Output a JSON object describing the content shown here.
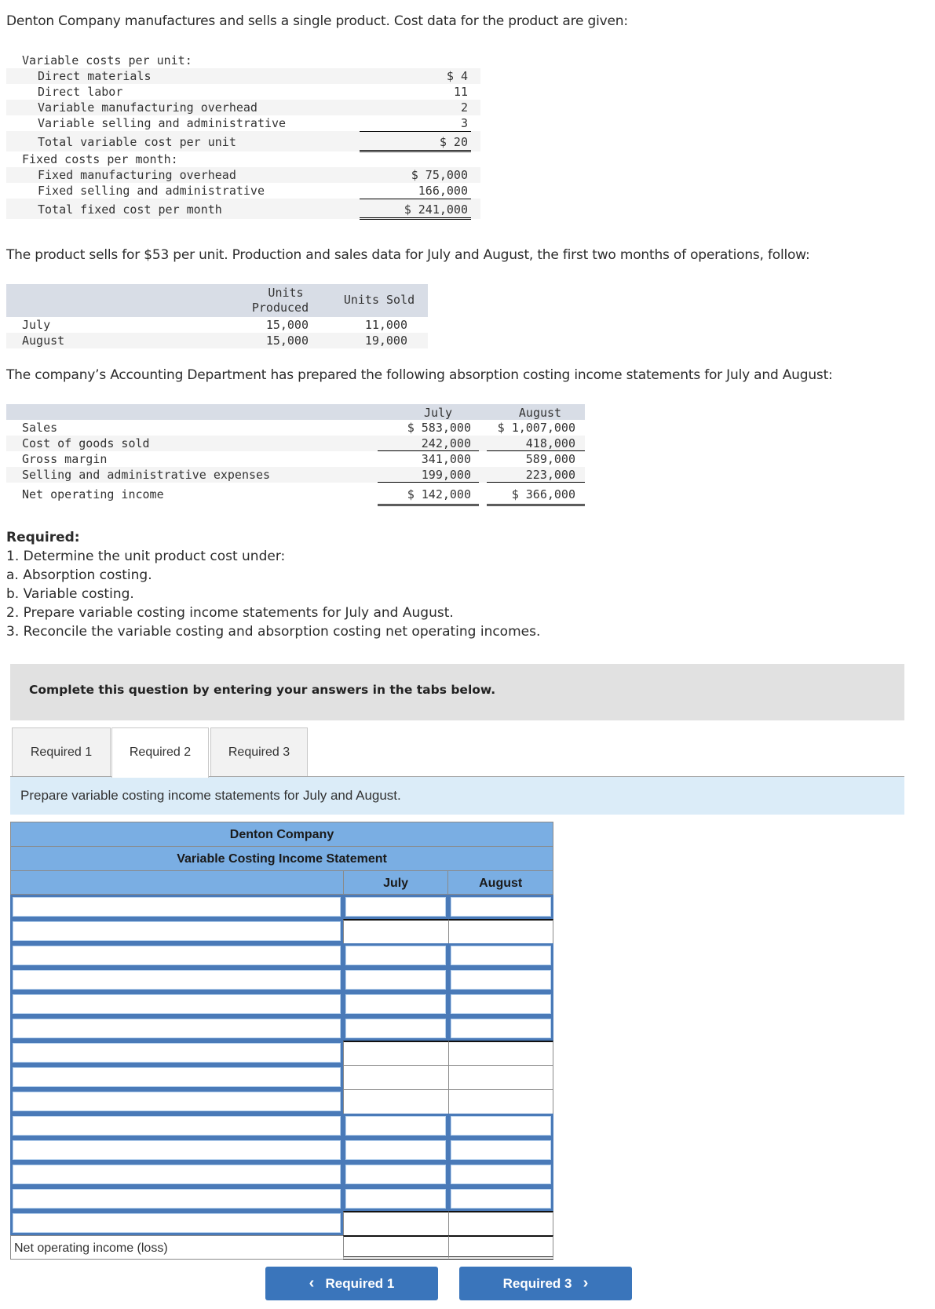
{
  "intro": "Denton Company manufactures and sells a single product. Cost data for the product are given:",
  "cost_table": {
    "variable_header": "Variable costs per unit:",
    "variable_items": [
      {
        "label": "Direct materials",
        "value": "$ 4"
      },
      {
        "label": "Direct labor",
        "value": "11"
      },
      {
        "label": "Variable manufacturing overhead",
        "value": "2"
      },
      {
        "label": "Variable selling and administrative",
        "value": "3"
      }
    ],
    "variable_total": {
      "label": "Total variable cost per unit",
      "value": "$ 20"
    },
    "fixed_header": "Fixed costs per month:",
    "fixed_items": [
      {
        "label": "Fixed manufacturing overhead",
        "value": "$ 75,000"
      },
      {
        "label": "Fixed selling and administrative",
        "value": "166,000"
      }
    ],
    "fixed_total": {
      "label": "Total fixed cost per month",
      "value": "$ 241,000"
    }
  },
  "para2": "The product sells for $53 per unit. Production and sales data for July and August, the first two months of operations, follow:",
  "units_table": {
    "headers": [
      "Units",
      "Produced",
      "Units Sold"
    ],
    "rows": [
      {
        "month": "July",
        "produced": "15,000",
        "sold": "11,000"
      },
      {
        "month": "August",
        "produced": "15,000",
        "sold": "19,000"
      }
    ]
  },
  "para3": "The company’s Accounting Department has prepared the following absorption costing income statements for July and August:",
  "absorption_table": {
    "headers": [
      "July",
      "August"
    ],
    "rows": [
      {
        "label": "Sales",
        "july": "$ 583,000",
        "august": "$ 1,007,000"
      },
      {
        "label": "Cost of goods sold",
        "july": "242,000",
        "august": "418,000"
      },
      {
        "label": "Gross margin",
        "july": "341,000",
        "august": "589,000"
      },
      {
        "label": "Selling and administrative expenses",
        "july": "199,000",
        "august": "223,000"
      },
      {
        "label": "Net operating income",
        "july": "$ 142,000",
        "august": "$ 366,000"
      }
    ]
  },
  "required": {
    "title": "Required:",
    "lines": [
      "1. Determine the unit product cost under:",
      "a. Absorption costing.",
      "b. Variable costing.",
      "2. Prepare variable costing income statements for July and August.",
      "3. Reconcile the variable costing and absorption costing net operating incomes."
    ]
  },
  "banner": "Complete this question by entering your answers in the tabs below.",
  "tabs": [
    {
      "label": "Required 1",
      "active": false
    },
    {
      "label": "Required 2",
      "active": true
    },
    {
      "label": "Required 3",
      "active": false
    }
  ],
  "instruction": "Prepare variable costing income statements for July and August.",
  "statement": {
    "company": "Denton Company",
    "title": "Variable Costing Income Statement",
    "columns": [
      "July",
      "August"
    ],
    "rows": [
      {
        "label": "",
        "july": "",
        "august": "",
        "type": "input"
      },
      {
        "label": "",
        "type": "label-only"
      },
      {
        "label": "",
        "july": "",
        "august": "",
        "type": "input"
      },
      {
        "label": "",
        "july": "",
        "august": "",
        "type": "input"
      },
      {
        "label": "",
        "july": "",
        "august": "",
        "type": "input"
      },
      {
        "label": "",
        "july": "",
        "august": "",
        "type": "input"
      },
      {
        "label": "",
        "type": "label-only"
      },
      {
        "label": "",
        "type": "label-only"
      },
      {
        "label": "",
        "type": "label-only"
      },
      {
        "label": "",
        "july": "",
        "august": "",
        "type": "input"
      },
      {
        "label": "",
        "july": "",
        "august": "",
        "type": "input"
      },
      {
        "label": "",
        "july": "",
        "august": "",
        "type": "input"
      },
      {
        "label": "",
        "july": "",
        "august": "",
        "type": "input"
      },
      {
        "label": "",
        "type": "label-only"
      }
    ],
    "total_label": "Net operating income (loss)"
  },
  "nav": {
    "prev_label": "Required 1",
    "next_label": "Required 3",
    "prev_icon": "‹",
    "next_icon": "›"
  }
}
